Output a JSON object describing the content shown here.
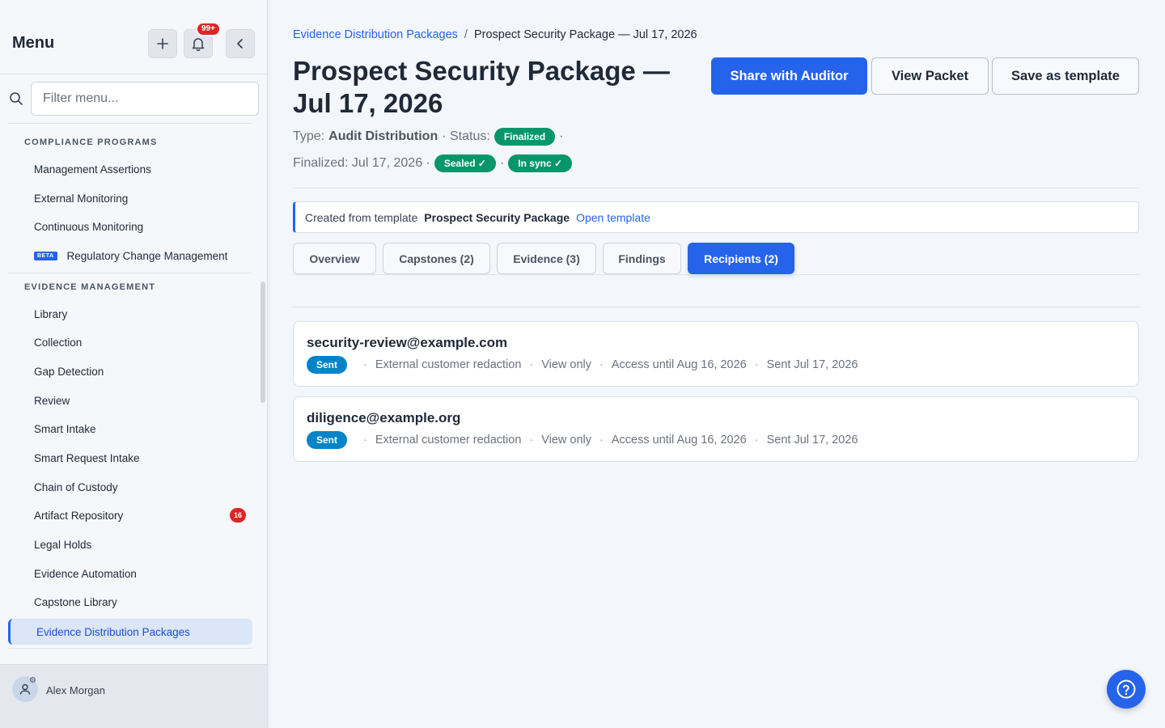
{
  "sidebar": {
    "title": "Menu",
    "notification_count": "99+",
    "filter_placeholder": "Filter menu...",
    "sections": [
      {
        "title": "COMPLIANCE PROGRAMS",
        "items": [
          {
            "label": "Management Assertions"
          },
          {
            "label": "External Monitoring"
          },
          {
            "label": "Continuous Monitoring"
          },
          {
            "label": "Regulatory Change Management",
            "badge": "BETA"
          }
        ]
      },
      {
        "title": "EVIDENCE MANAGEMENT",
        "items": [
          {
            "label": "Library"
          },
          {
            "label": "Collection"
          },
          {
            "label": "Gap Detection"
          },
          {
            "label": "Review"
          },
          {
            "label": "Smart Intake"
          },
          {
            "label": "Smart Request Intake"
          },
          {
            "label": "Chain of Custody"
          },
          {
            "label": "Artifact Repository",
            "count": "16"
          },
          {
            "label": "Legal Holds"
          },
          {
            "label": "Evidence Automation"
          },
          {
            "label": "Capstone Library"
          },
          {
            "label": "Evidence Distribution Packages",
            "active": true
          }
        ]
      }
    ],
    "user": {
      "name": "Alex Morgan"
    }
  },
  "main": {
    "breadcrumb": {
      "parent": "Evidence Distribution Packages",
      "separator": "/",
      "current": "Prospect Security Package — Jul 17, 2026"
    },
    "title": "Prospect Security Package — Jul 17, 2026",
    "actions": {
      "share": "Share with Auditor",
      "view": "View Packet",
      "save": "Save as template"
    },
    "meta": {
      "type_label": "Type:",
      "type_value": "Audit Distribution",
      "status_label": "· Status:",
      "status_value": "Finalized",
      "finalized_label": "Finalized: Jul 17, 2026 ·",
      "sealed": "Sealed ✓",
      "in_sync": "In sync ✓",
      "sep": "·"
    },
    "template_note": {
      "prefix": "Created from template",
      "name": "Prospect Security Package",
      "link": "Open template"
    },
    "tabs": [
      {
        "label": "Overview"
      },
      {
        "label": "Capstones (2)"
      },
      {
        "label": "Evidence (3)"
      },
      {
        "label": "Findings"
      },
      {
        "label": "Recipients (2)",
        "active": true
      }
    ],
    "recipients": [
      {
        "email": "security-review@example.com",
        "status": "Sent",
        "redaction": "External customer redaction",
        "access": "View only",
        "expiry": "Access until Aug 16, 2026",
        "sent": "Sent Jul 17, 2026"
      },
      {
        "email": "diligence@example.org",
        "status": "Sent",
        "redaction": "External customer redaction",
        "access": "View only",
        "expiry": "Access until Aug 16, 2026",
        "sent": "Sent Jul 17, 2026"
      }
    ]
  },
  "colors": {
    "accent": "#2563eb",
    "success": "#059669",
    "sent": "#0284c7",
    "danger": "#dc2626"
  }
}
